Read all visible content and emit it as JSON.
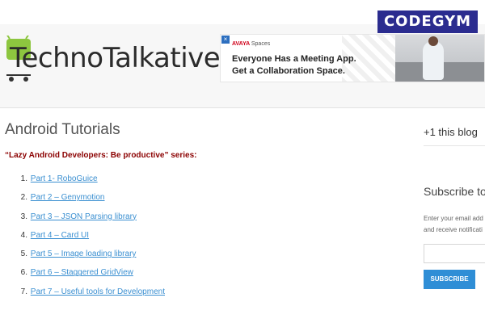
{
  "watermark": {
    "text": "CODEGYM"
  },
  "site": {
    "logo_part1": "Techno",
    "logo_part2": "Talkative"
  },
  "ad": {
    "close_icon": "close-icon",
    "brand": "AVAYA",
    "brand_sub": "Spaces",
    "line1": "Everyone Has a Meeting App.",
    "line2": "Get a Collaboration Space."
  },
  "main": {
    "title": "Android Tutorials",
    "series_title": "“Lazy Android Developers: Be productive” series:",
    "tutorials": [
      {
        "num": "1.",
        "label": "Part 1- RoboGuice"
      },
      {
        "num": "2.",
        "label": "Part 2 – Genymotion"
      },
      {
        "num": "3.",
        "label": "Part 3 – JSON Parsing library"
      },
      {
        "num": "4.",
        "label": "Part 4 – Card UI"
      },
      {
        "num": "5.",
        "label": "Part 5 – Image loading library"
      },
      {
        "num": "6.",
        "label": "Part 6 – Staggered GridView"
      },
      {
        "num": "7.",
        "label": "Part 7 – Useful tools for Development"
      }
    ]
  },
  "sidebar": {
    "plus_blog": "+1 this blog",
    "subscribe_title": "Subscribe to",
    "subscribe_desc1": "Enter your email add",
    "subscribe_desc2": "and receive notificati",
    "subscribe_button": "SUBSCRIBE"
  },
  "colors": {
    "link": "#3a8fd1",
    "series_title": "#8b0000",
    "button": "#2f8ed6",
    "watermark_bg": "#2b2c8f"
  }
}
